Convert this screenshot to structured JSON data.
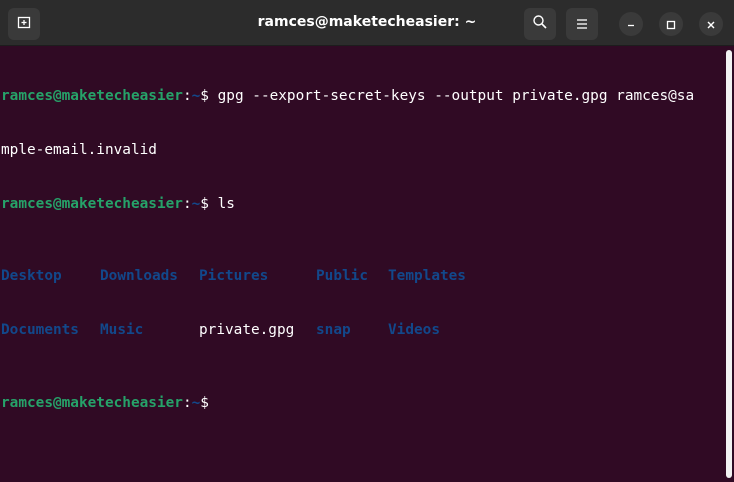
{
  "window": {
    "title": "ramces@maketecheasier: ~",
    "controls": {
      "new_tab_icon": "new-tab-icon",
      "search_icon": "search-icon",
      "menu_icon": "hamburger-menu-icon",
      "minimize_icon": "minimize-icon",
      "maximize_icon": "maximize-icon",
      "close_icon": "close-icon"
    }
  },
  "colors": {
    "terminal_bg": "#300a24",
    "prompt_user": "#26a269",
    "prompt_path": "#12488b",
    "directory": "#12488b",
    "titlebar": "#2c2c2c"
  },
  "terminal": {
    "prompt_user": "ramces@maketecheasier",
    "prompt_sep": ":",
    "prompt_path": "~",
    "prompt_dollar": "$ ",
    "cmd1_part1": "gpg --export-secret-keys --output private.gpg ramces@sa",
    "cmd1_part2": "mple-email.invalid",
    "cmd2": "ls",
    "ls_output": [
      [
        "Desktop",
        "Downloads",
        "Pictures",
        "Public",
        "Templates"
      ],
      [
        "Documents",
        "Music",
        "private.gpg",
        "snap",
        "Videos"
      ]
    ]
  }
}
